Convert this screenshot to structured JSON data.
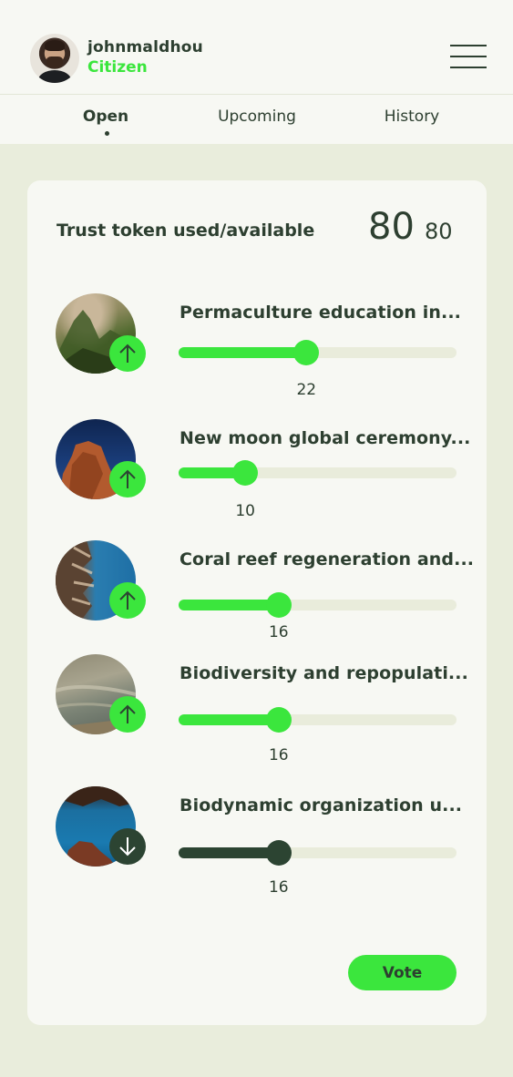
{
  "user": {
    "name": "johnmaldhou",
    "role": "Citizen"
  },
  "tabs": [
    {
      "label": "Open",
      "active": true
    },
    {
      "label": "Upcoming",
      "active": false
    },
    {
      "label": "History",
      "active": false
    }
  ],
  "trust": {
    "label": "Trust token used/available",
    "used": "80",
    "available": "80"
  },
  "proposals": [
    {
      "title": "Permaculture education in...",
      "value": "22",
      "direction": "up",
      "icon": "arrow-up-icon",
      "fraction": 0.46
    },
    {
      "title": "New moon global ceremony...",
      "value": "10",
      "direction": "up",
      "icon": "arrow-up-icon",
      "fraction": 0.24
    },
    {
      "title": "Coral reef regeneration and...",
      "value": "16",
      "direction": "up",
      "icon": "arrow-up-icon",
      "fraction": 0.36
    },
    {
      "title": "Biodiversity and repopulati...",
      "value": "16",
      "direction": "up",
      "icon": "arrow-up-icon",
      "fraction": 0.36
    },
    {
      "title": "Biodynamic organization u...",
      "value": "16",
      "direction": "down",
      "icon": "arrow-down-icon",
      "fraction": 0.36
    }
  ],
  "vote_button": {
    "label": "Vote"
  },
  "colors": {
    "accent": "#3be63d",
    "dark": "#2c4432",
    "text": "#2d3f30",
    "track": "#e9ecdb",
    "background": "#e9eddc",
    "card": "#f7f8f3"
  }
}
